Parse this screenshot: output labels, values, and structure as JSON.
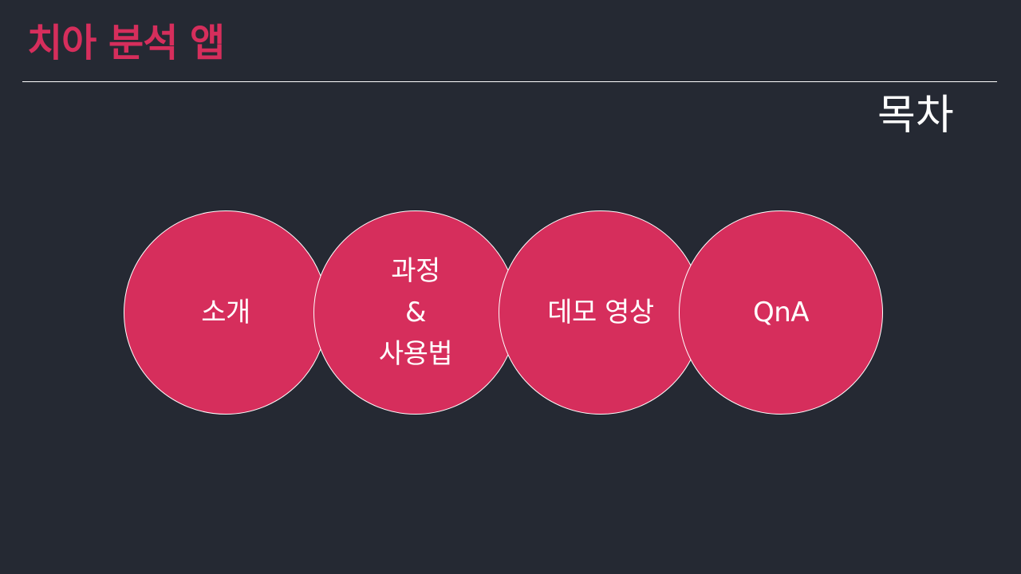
{
  "theme": {
    "background": "#252933",
    "accent": "#d62e5c",
    "text": "#ffffff"
  },
  "slide": {
    "title": "치아 분석 앱",
    "section_label": "목차"
  },
  "agenda": {
    "items": [
      {
        "label": "소개"
      },
      {
        "label": "과정\n&\n사용법"
      },
      {
        "label": "데모 영상"
      },
      {
        "label": "QnA"
      }
    ]
  }
}
